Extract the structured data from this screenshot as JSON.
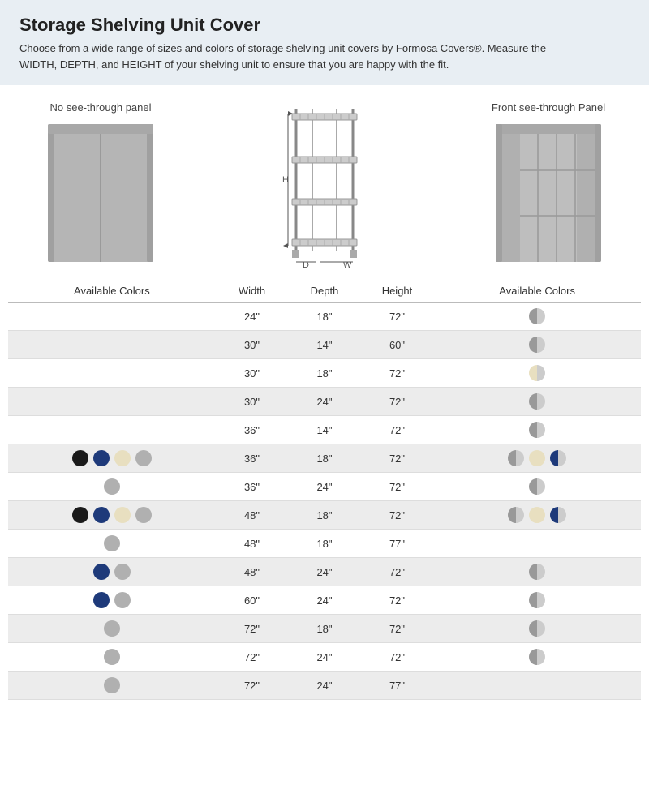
{
  "header": {
    "title": "Storage Shelving Unit Cover",
    "description": "Choose from a wide range of sizes and colors of storage shelving unit covers by Formosa Covers®. Measure the WIDTH, DEPTH, and HEIGHT of your shelving unit to ensure that you are happy with the fit."
  },
  "diagrams": {
    "left_label": "No see-through panel",
    "right_label": "Front see-through Panel"
  },
  "table": {
    "headers": {
      "left_colors": "Available Colors",
      "width": "Width",
      "depth": "Depth",
      "height": "Height",
      "right_colors": "Available Colors"
    },
    "rows": [
      {
        "width": "24\"",
        "depth": "18\"",
        "height": "72\"",
        "left_colors": [],
        "right_colors": [
          "half-moon"
        ]
      },
      {
        "width": "30\"",
        "depth": "14\"",
        "height": "60\"",
        "left_colors": [],
        "right_colors": [
          "half-moon"
        ]
      },
      {
        "width": "30\"",
        "depth": "18\"",
        "height": "72\"",
        "left_colors": [],
        "right_colors": [
          "cream-half"
        ]
      },
      {
        "width": "30\"",
        "depth": "24\"",
        "height": "72\"",
        "left_colors": [],
        "right_colors": [
          "half-moon"
        ]
      },
      {
        "width": "36\"",
        "depth": "14\"",
        "height": "72\"",
        "left_colors": [],
        "right_colors": [
          "half-moon"
        ]
      },
      {
        "width": "36\"",
        "depth": "18\"",
        "height": "72\"",
        "left_colors": [
          "black",
          "navy",
          "cream",
          "gray"
        ],
        "right_colors": [
          "half-moon",
          "cream",
          "navy-half"
        ]
      },
      {
        "width": "36\"",
        "depth": "24\"",
        "height": "72\"",
        "left_colors": [
          "gray"
        ],
        "right_colors": [
          "half-moon"
        ]
      },
      {
        "width": "48\"",
        "depth": "18\"",
        "height": "72\"",
        "left_colors": [
          "black",
          "navy",
          "cream",
          "gray"
        ],
        "right_colors": [
          "half-moon",
          "cream",
          "navy-half"
        ]
      },
      {
        "width": "48\"",
        "depth": "18\"",
        "height": "77\"",
        "left_colors": [
          "gray"
        ],
        "right_colors": []
      },
      {
        "width": "48\"",
        "depth": "24\"",
        "height": "72\"",
        "left_colors": [
          "navy",
          "gray"
        ],
        "right_colors": [
          "half-moon"
        ]
      },
      {
        "width": "60\"",
        "depth": "24\"",
        "height": "72\"",
        "left_colors": [
          "navy",
          "gray"
        ],
        "right_colors": [
          "half-moon"
        ]
      },
      {
        "width": "72\"",
        "depth": "18\"",
        "height": "72\"",
        "left_colors": [
          "gray"
        ],
        "right_colors": [
          "half-moon"
        ]
      },
      {
        "width": "72\"",
        "depth": "24\"",
        "height": "72\"",
        "left_colors": [
          "gray"
        ],
        "right_colors": [
          "half-moon"
        ]
      },
      {
        "width": "72\"",
        "depth": "24\"",
        "height": "77\"",
        "left_colors": [
          "gray"
        ],
        "right_colors": []
      }
    ]
  }
}
